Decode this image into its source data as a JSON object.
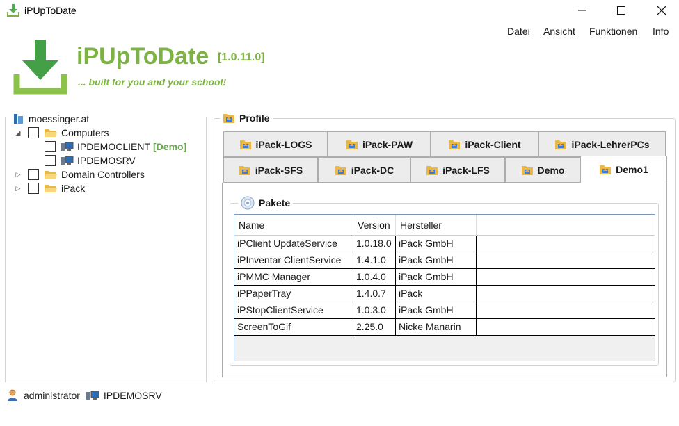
{
  "window": {
    "title": "iPUpToDate"
  },
  "menu": {
    "items": [
      "Datei",
      "Ansicht",
      "Funktionen",
      "Info"
    ]
  },
  "logo": {
    "title": "iPUpToDate",
    "version": "[1.0.11.0]",
    "tagline": "... built for you and your school!"
  },
  "tree": {
    "root": "moessinger.at",
    "computers": "Computers",
    "client": "IPDEMOCLIENT",
    "client_tag": "[Demo]",
    "server": "IPDEMOSRV",
    "domain_controllers": "Domain Controllers",
    "ipack": "iPack"
  },
  "profile": {
    "label": "Profile",
    "tabs_row1": [
      "iPack-LOGS",
      "iPack-PAW",
      "iPack-Client",
      "iPack-LehrerPCs"
    ],
    "tabs_row2": [
      "iPack-SFS",
      "iPack-DC",
      "iPack-LFS",
      "Demo",
      "Demo1"
    ],
    "active_tab": "Demo1"
  },
  "pakete": {
    "label": "Pakete",
    "columns": [
      "Name",
      "Version",
      "Hersteller"
    ],
    "rows": [
      [
        "iPClient UpdateService",
        "1.0.18.0",
        "iPack GmbH"
      ],
      [
        "iPInventar ClientService",
        "1.4.1.0",
        "iPack GmbH"
      ],
      [
        "iPMMC Manager",
        "1.0.4.0",
        "iPack GmbH"
      ],
      [
        "iPPaperTray",
        "1.4.0.7",
        "iPack"
      ],
      [
        "iPStopClientService",
        "1.0.3.0",
        "iPack GmbH"
      ],
      [
        "ScreenToGif",
        "2.25.0",
        "Nicke Manarin"
      ]
    ]
  },
  "status": {
    "user": "administrator",
    "host": "IPDEMOSRV"
  },
  "colors": {
    "brand_green": "#7cb342",
    "folder_yellow": "#f2c14e",
    "grid_border": "#7a98b8"
  }
}
